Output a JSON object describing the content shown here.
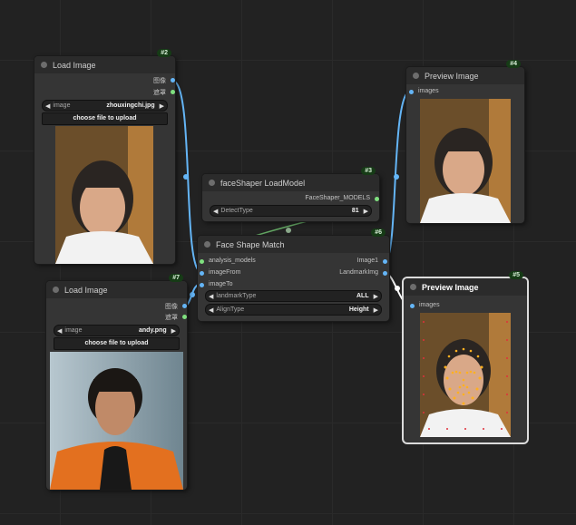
{
  "nodes": {
    "load_image_1": {
      "badge": "#2",
      "title": "Load Image",
      "outputs": [
        "图像",
        "遮罩"
      ],
      "widget": {
        "label": "image",
        "value": "zhouxingchi.jpg"
      },
      "upload_label": "choose file to upload"
    },
    "load_image_2": {
      "badge": "#7",
      "title": "Load Image",
      "outputs": [
        "图像",
        "遮罩"
      ],
      "widget": {
        "label": "image",
        "value": "andy.png"
      },
      "upload_label": "choose file to upload"
    },
    "face_shaper_load_model": {
      "badge": "#3",
      "title": "faceShaper LoadModel",
      "output": "FaceShaper_MODELS",
      "widget": {
        "label": "DetectType",
        "value": "81"
      }
    },
    "face_shape_match": {
      "badge": "#6",
      "title": "Face Shape Match",
      "inputs": [
        "analysis_models",
        "imageFrom",
        "imageTo"
      ],
      "outputs": [
        "Image1",
        "LandmarkImg"
      ],
      "widgets": [
        {
          "label": "landmarkType",
          "value": "ALL"
        },
        {
          "label": "AlignType",
          "value": "Height"
        }
      ]
    },
    "preview_image_1": {
      "badge": "#4",
      "title": "Preview Image",
      "input": "images"
    },
    "preview_image_2": {
      "badge": "#5",
      "title": "Preview Image",
      "input": "images"
    }
  },
  "colors": {
    "canvas": "#222222",
    "node_body": "#353535",
    "node_header": "#2b2b2b",
    "badge": "#163b16",
    "image_link": "#64b5f6",
    "model_link": "#7fe07f",
    "landmark_link": "#ffffff"
  }
}
